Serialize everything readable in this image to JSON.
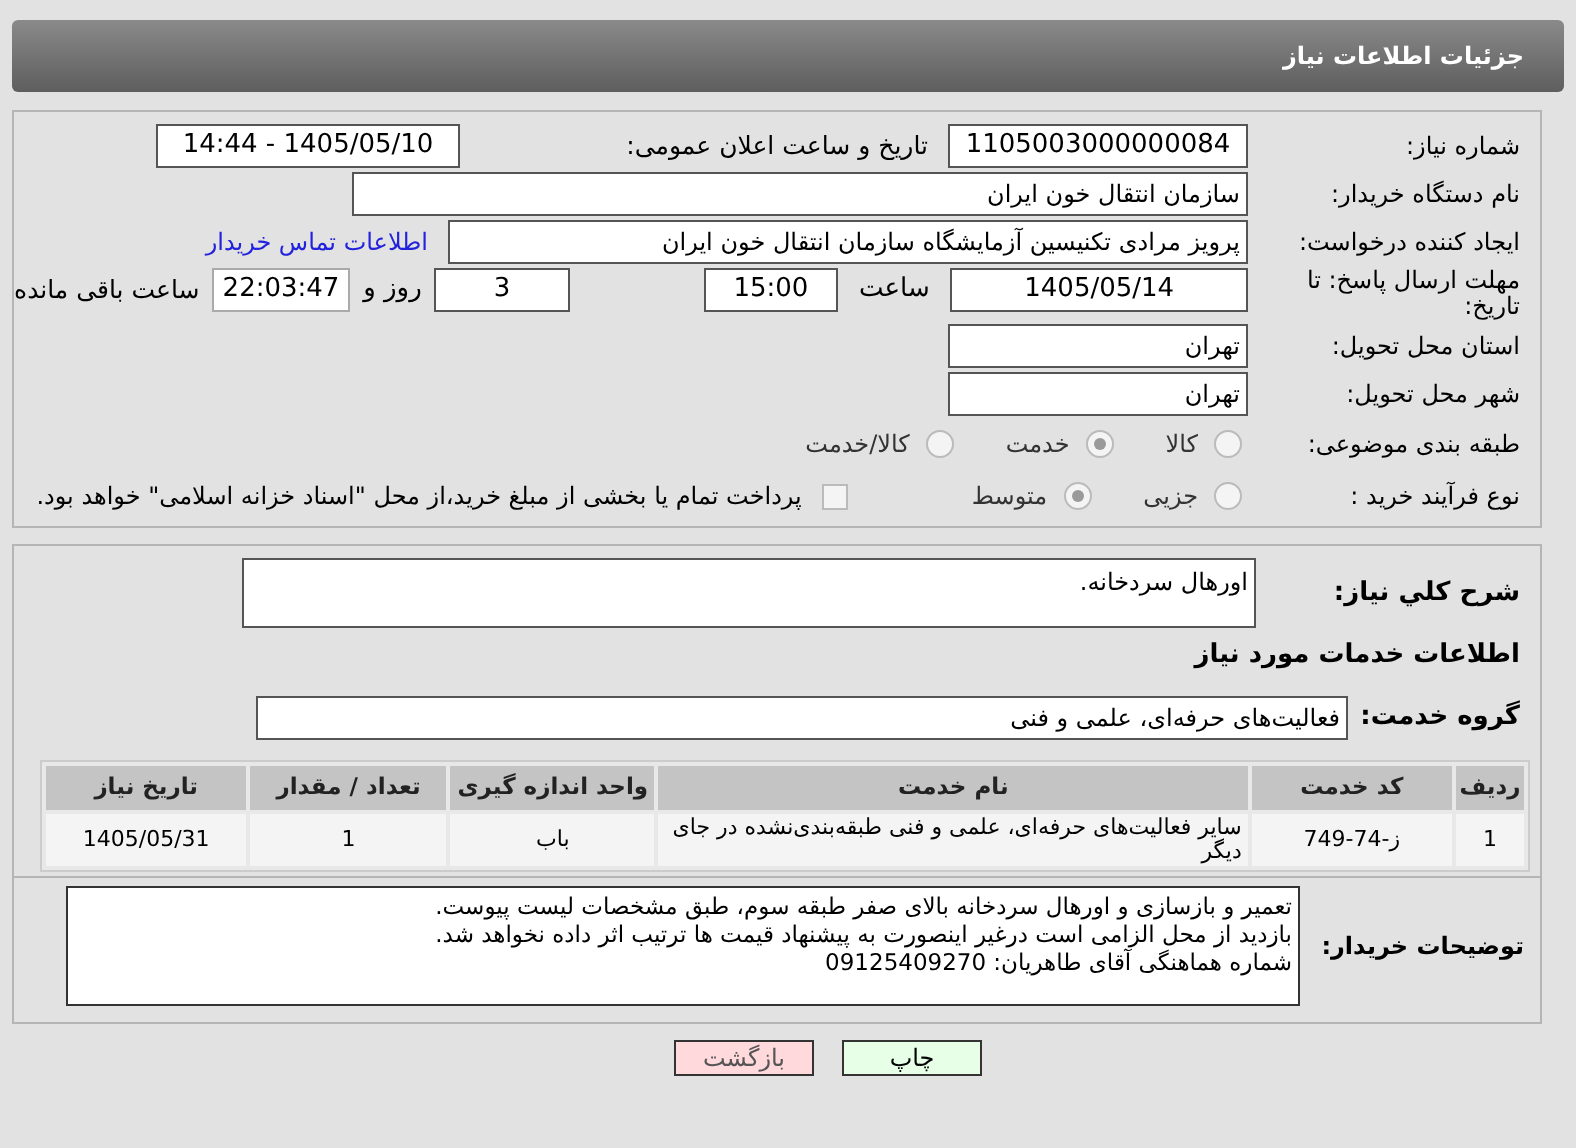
{
  "header": {
    "title": "جزئیات اطلاعات نیاز"
  },
  "need_info": {
    "need_number": {
      "label": "شماره نیاز:",
      "value": "1105003000000084"
    },
    "announce": {
      "label": "تاریخ و ساعت اعلان عمومی:",
      "value": "1405/05/10 - 14:44"
    },
    "buyer_org": {
      "label": "نام دستگاه خریدار:",
      "value": "سازمان انتقال خون ایران"
    },
    "requester": {
      "label": "ایجاد کننده درخواست:",
      "value": "پرویز مرادی تکنیسین آزمایشگاه سازمان انتقال خون ایران",
      "link": "اطلاعات تماس خریدار"
    },
    "deadline": {
      "label": "مهلت ارسال پاسخ: تا تاریخ:",
      "date": "1405/05/14",
      "time_label": "ساعت",
      "time": "15:00",
      "days": "3",
      "days_label": "روز و",
      "remaining": "22:03:47",
      "remaining_label": "ساعت باقی مانده"
    },
    "province": {
      "label": "استان محل تحویل:",
      "value": "تهران"
    },
    "city": {
      "label": "شهر محل تحویل:",
      "value": "تهران"
    },
    "category": {
      "label": "طبقه بندی موضوعی:",
      "options": [
        {
          "label": "کالا",
          "selected": false
        },
        {
          "label": "خدمت",
          "selected": true
        },
        {
          "label": "کالا/خدمت",
          "selected": false
        }
      ]
    },
    "purchase_type": {
      "label": "نوع فرآیند خرید :",
      "options": [
        {
          "label": "جزیی",
          "selected": false
        },
        {
          "label": "متوسط",
          "selected": true
        }
      ],
      "payment": {
        "label": "پرداخت تمام یا بخشی از مبلغ خرید،از محل \"اسناد خزانه اسلامی\" خواهد بود.",
        "checked": false
      }
    }
  },
  "summary": {
    "label": "شرح کلي نياز:",
    "value": "اورهال سردخانه."
  },
  "services": {
    "title": "اطلاعات خدمات مورد نیاز",
    "group_label": "گروه خدمت:",
    "group": "فعالیت‌های حرفه‌ای، علمی و فنی",
    "table": {
      "columns": [
        "ردیف",
        "کد خدمت",
        "نام خدمت",
        "واحد اندازه گیری",
        "تعداد / مقدار",
        "تاریخ نیاز"
      ],
      "rows": [
        [
          "1",
          "ز-74-749",
          "سایر فعالیت‌های حرفه‌ای، علمی و فنی طبقه‌بندی‌نشده در جای دیگر",
          "باب",
          "1",
          "1405/05/31"
        ]
      ]
    }
  },
  "buyer_notes": {
    "label": "توضیحات خریدار:",
    "lines": [
      "تعمیر و بازسازی و اورهال سردخانه بالای صفر طبقه سوم، طبق مشخصات لیست پیوست.",
      "بازدید از محل الزامی است درغیر اینصورت به پیشنهاد قیمت ها ترتیب اثر داده نخواهد شد.",
      "شماره هماهنگی آقای طاهریان: 09125409270"
    ]
  },
  "buttons": [
    {
      "kind": "print",
      "label": "چاپ"
    },
    {
      "kind": "back",
      "label": "بازگشت"
    }
  ]
}
